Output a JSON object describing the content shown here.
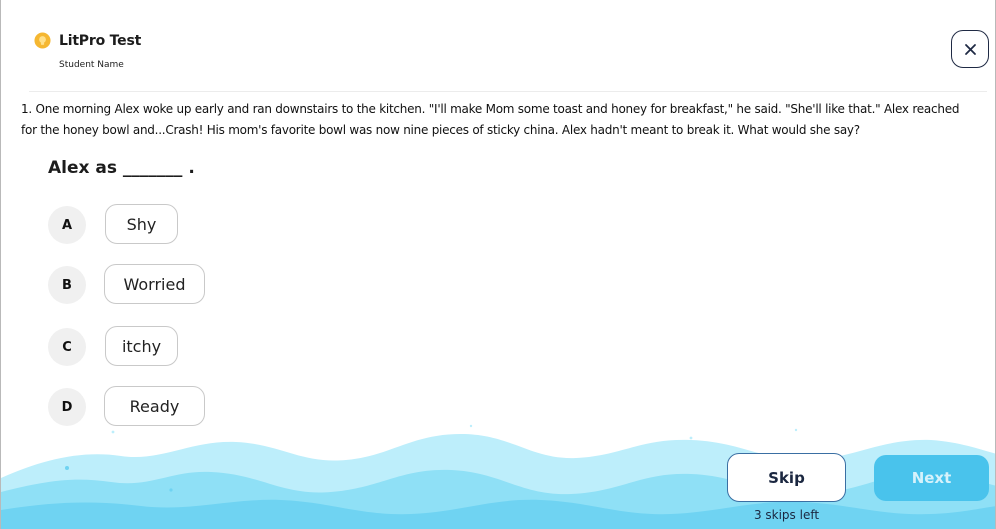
{
  "header": {
    "app_title": "LitPro Test",
    "student_name": "Student Name",
    "logo_icon": "bulb-icon",
    "close_icon": "close-icon"
  },
  "question": {
    "passage": "1. One morning Alex woke up early and ran downstairs to the kitchen. \"I'll make Mom some toast and honey for breakfast,\" he said. \"She'll like that.\" Alex reached for the honey bowl and...Crash! His mom's favorite bowl was now nine pieces of sticky china. Alex hadn't meant to break it. What would she say?",
    "stem": "Alex as _______ .",
    "options": [
      {
        "letter": "A",
        "label": "Shy"
      },
      {
        "letter": "B",
        "label": "Worried"
      },
      {
        "letter": "C",
        "label": "itchy"
      },
      {
        "letter": "D",
        "label": "Ready"
      }
    ]
  },
  "footer": {
    "skip_label": "Skip",
    "skips_left": "3 skips left",
    "next_label": "Next"
  },
  "colors": {
    "accent": "#49c3ec",
    "water_dark": "#6fd3f2",
    "water_light": "#bdeefb",
    "close_border": "#1f2a44",
    "logo": "#f5b731"
  }
}
